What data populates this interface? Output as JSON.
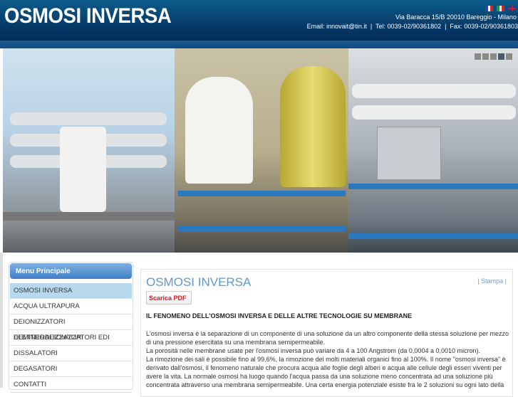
{
  "header": {
    "logo": "OSMOSI INVERSA",
    "address": "Via Baracca 15/B 20010 Bareggio - Milano",
    "contact": "Email: innovait@tin.it  |  Tel: 0039-02/90361802  |  Fax: 0039-02/90361803",
    "flags": [
      "French flag",
      "Italian flag",
      "UK flag"
    ]
  },
  "slider": {
    "slides": 5,
    "active_index": 3
  },
  "menu": {
    "title": "Menu Principale",
    "items": [
      "OSMOSI INVERSA",
      "ACQUA ULTRAPURA",
      "DEIONIZZATORI DEMINERALIZZATORI",
      "ELETTRODEIONIZZATORI EDI",
      "DISSALATORI",
      "DEGASATORI",
      "CONTATTI"
    ]
  },
  "content": {
    "title": "OSMOSI INVERSA",
    "print": "| Stampa |",
    "pdf": "Scarica PDF",
    "subheading": "IL FENOMENO DELL'OSMOSI INVERSA E DELLE ALTRE TECNOLOGIE SU MEMBRANE",
    "paragraphs": [
      "L'osmosi inversa è la separazione di un componente di una soluzione da un altro componente della stessa soluzione per mezzo di una pressione esercitata su una membrana semipermeabile.",
      "La porosità nelle membrane usate per l'osmosi inversa può variare da 4 a 100 Angstrom (da 0,0004 a 0,0010 micron).",
      "La rimozione dei sali è possibile fino al 99,6%, la rimozione dei molti materiali organici fino al 100%. Il nome \"osmosi inversa\" è derivato dall'osmosi, il fenomeno naturale che procura acqua alle foglie degli alberi e acqua alle cellule degli esseri viventi per avere la vita. La normale osmosi ha luogo quando l'acqua passa da una soluzione meno concentrata ad una soluzione più concentrata attraverso una membrana semipermeabile. Una certa energia potenziale esiste fra le 2 soluzioni su ogni lato della"
    ]
  }
}
